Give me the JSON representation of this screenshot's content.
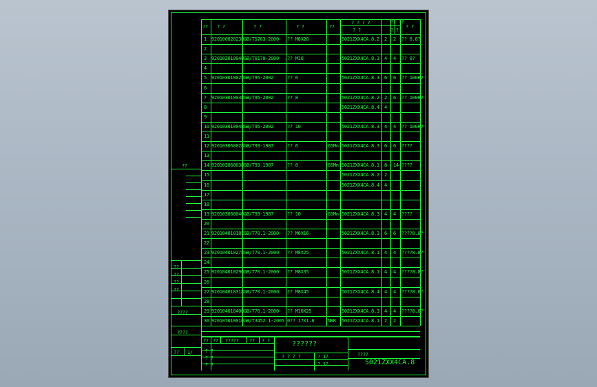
{
  "header": {
    "idx": "??",
    "code": "? ?",
    "std": "? ?",
    "name": "? ?",
    "mat": "??",
    "grp_top": "? ? ? ?",
    "grp_sub": "? ?",
    "qty": "??\n??",
    "qty2": "? ?",
    "note": "? ?"
  },
  "rows": [
    {
      "n": "1",
      "code": "920100020230",
      "std": "GB/T5783-2000",
      "name": "?? M8X20",
      "mat": "",
      "dwg": "5021ZXX4CA.8.2",
      "q1": "2",
      "q2": "2",
      "note": "?? 8.8?"
    },
    {
      "n": "2",
      "code": "",
      "std": "",
      "name": "",
      "mat": "",
      "dwg": "",
      "q1": "",
      "q2": "",
      "note": ""
    },
    {
      "n": "3",
      "code": "920102010040",
      "std": "GB/T6170-2000",
      "name": "?? M10",
      "mat": "",
      "dwg": "5021ZXX4CA.8.3",
      "q1": "4",
      "q2": "4",
      "note": "?? 8?"
    },
    {
      "n": "4",
      "code": "",
      "std": "",
      "name": "",
      "mat": "",
      "dwg": "",
      "q1": "",
      "q2": "",
      "note": ""
    },
    {
      "n": "5",
      "code": "920103010029",
      "std": "GB/T95-2002",
      "name": "?? 6",
      "mat": "",
      "dwg": "5021ZXX4CA.8.3",
      "q1": "6",
      "q2": "6",
      "note": "?? 100HV"
    },
    {
      "n": "6",
      "code": "",
      "std": "",
      "name": "",
      "mat": "",
      "dwg": "",
      "q1": "",
      "q2": "",
      "note": ""
    },
    {
      "n": "7",
      "code": "920103010038",
      "std": "GB/T95-2002",
      "name": "?? 8",
      "mat": "",
      "dwg": "5021ZXX4CA.8.2",
      "q1": "2",
      "q2": "6",
      "note": "?? 100HV"
    },
    {
      "n": "8",
      "code": "",
      "std": "",
      "name": "",
      "mat": "",
      "dwg": "5021ZXX4CA.8.4",
      "q1": "4",
      "q2": "",
      "note": ""
    },
    {
      "n": "9",
      "code": "",
      "std": "",
      "name": "",
      "mat": "",
      "dwg": "",
      "q1": "",
      "q2": "",
      "note": ""
    },
    {
      "n": "10",
      "code": "920103010048",
      "std": "GB/T95-2002",
      "name": "?? 10",
      "mat": "",
      "dwg": "5021ZXX4CA.8.3",
      "q1": "4",
      "q2": "4",
      "note": "?? 100HV"
    },
    {
      "n": "11",
      "code": "",
      "std": "",
      "name": "",
      "mat": "",
      "dwg": "",
      "q1": "",
      "q2": "",
      "note": ""
    },
    {
      "n": "12",
      "code": "920103060028",
      "std": "GB/T93-1987",
      "name": "?? 6",
      "mat": "65Mn",
      "dwg": "5021ZXX4CA.8.3",
      "q1": "6",
      "q2": "6",
      "note": "????"
    },
    {
      "n": "13",
      "code": "",
      "std": "",
      "name": "",
      "mat": "",
      "dwg": "",
      "q1": "",
      "q2": "",
      "note": ""
    },
    {
      "n": "14",
      "code": "920103060038",
      "std": "GB/T93-1987",
      "name": "?? 8",
      "mat": "65Mn",
      "dwg": "5021ZXX4CA.8.1",
      "q1": "8",
      "q2": "14",
      "note": "????"
    },
    {
      "n": "15",
      "code": "",
      "std": "",
      "name": "",
      "mat": "",
      "dwg": "5021ZXX4CA.8.2",
      "q1": "2",
      "q2": "",
      "note": ""
    },
    {
      "n": "16",
      "code": "",
      "std": "",
      "name": "",
      "mat": "",
      "dwg": "5021ZXX4CA.8.4",
      "q1": "4",
      "q2": "",
      "note": ""
    },
    {
      "n": "17",
      "code": "",
      "std": "",
      "name": "",
      "mat": "",
      "dwg": "",
      "q1": "",
      "q2": "",
      "note": ""
    },
    {
      "n": "18",
      "code": "",
      "std": "",
      "name": "",
      "mat": "",
      "dwg": "",
      "q1": "",
      "q2": "",
      "note": ""
    },
    {
      "n": "19",
      "code": "920103060040",
      "std": "GB/T93-1987",
      "name": "?? 10",
      "mat": "65Mn",
      "dwg": "5021ZXX4CA.8.3",
      "q1": "4",
      "q2": "4",
      "note": "????"
    },
    {
      "n": "20",
      "code": "",
      "std": "",
      "name": "",
      "mat": "",
      "dwg": "",
      "q1": "",
      "q2": "",
      "note": ""
    },
    {
      "n": "21",
      "code": "920104010181",
      "std": "GB/T70.1-2000",
      "name": "?? M6X16",
      "mat": "",
      "dwg": "5021ZXX4CA.8.3",
      "q1": "6",
      "q2": "6",
      "note": "????8.8?"
    },
    {
      "n": "22",
      "code": "",
      "std": "",
      "name": "",
      "mat": "",
      "dwg": "",
      "q1": "",
      "q2": "",
      "note": ""
    },
    {
      "n": "23",
      "code": "920104010278",
      "std": "GB/T70.1-2000",
      "name": "?? M8X25",
      "mat": "",
      "dwg": "5021ZXX4CA.8.1",
      "q1": "4",
      "q2": "4",
      "note": "????8.8?"
    },
    {
      "n": "24",
      "code": "",
      "std": "",
      "name": "",
      "mat": "",
      "dwg": "",
      "q1": "",
      "q2": "",
      "note": ""
    },
    {
      "n": "25",
      "code": "920104010290",
      "std": "GB/T70.1-2000",
      "name": "?? M8X35",
      "mat": "",
      "dwg": "5021ZXX4CA.8.1",
      "q1": "4",
      "q2": "4",
      "note": "????8.8?"
    },
    {
      "n": "26",
      "code": "",
      "std": "",
      "name": "",
      "mat": "",
      "dwg": "",
      "q1": "",
      "q2": "",
      "note": ""
    },
    {
      "n": "27",
      "code": "920104010318",
      "std": "GB/T70.1-2000",
      "name": "?? M8X45",
      "mat": "",
      "dwg": "5021ZXX4CA.8.4",
      "q1": "4",
      "q2": "4",
      "note": "????8.8?"
    },
    {
      "n": "28",
      "code": "",
      "std": "",
      "name": "",
      "mat": "",
      "dwg": "",
      "q1": "",
      "q2": "",
      "note": ""
    },
    {
      "n": "29",
      "code": "920104010400",
      "std": "GB/T70.1-2000",
      "name": "?? M10X25",
      "mat": "",
      "dwg": "5021ZXX4CA.8.3",
      "q1": "4",
      "q2": "4",
      "note": "????8.8?"
    },
    {
      "n": "30",
      "code": "920107010010",
      "std": "GB/T3452.1-2005",
      "name": "0?? 17X1.8",
      "mat": "NBR",
      "dwg": "5021ZXX4CA.8.1",
      "q1": "2",
      "q2": "2",
      "note": ""
    }
  ],
  "side": {
    "top_label": "??",
    "labels_a": [
      "??",
      "??",
      "??",
      "??"
    ],
    "label_b": "????",
    "label_c": "????",
    "label_d1": "??",
    "label_d2": "1/"
  },
  "title_block": {
    "title": "??????",
    "sub": "????",
    "doc_no": "5021ZXX4CA.8",
    "r1": [
      "??",
      "??",
      "?????",
      "??",
      "? ?"
    ],
    "r2": [
      "? ?",
      "? ?",
      "? ?"
    ],
    "mid1": "? ? ? ?",
    "mid2": [
      "? 1?",
      "? 1?"
    ]
  }
}
